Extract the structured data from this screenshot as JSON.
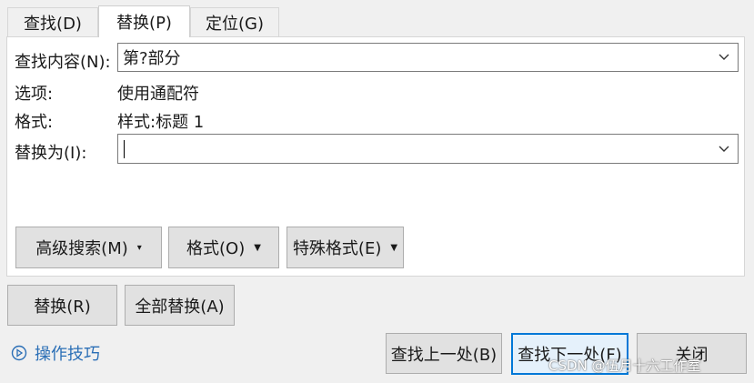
{
  "tabs": [
    "查找(D)",
    "替换(P)",
    "定位(G)"
  ],
  "find": {
    "label": "查找内容(N):",
    "value": "第?部分"
  },
  "options": {
    "label": "选项:",
    "value": "使用通配符"
  },
  "format": {
    "label": "格式:",
    "value": "样式:标题 1"
  },
  "replace": {
    "label": "替换为(I):",
    "value": ""
  },
  "panel_buttons": {
    "advanced": "高级搜索(M)",
    "format": "格式(O)",
    "special": "特殊格式(E)"
  },
  "action_buttons": {
    "replace": "替换(R)",
    "replace_all": "全部替换(A)"
  },
  "help": {
    "label": "操作技巧"
  },
  "footer_buttons": {
    "find_prev": "查找上一处(B)",
    "find_next": "查找下一处(F)",
    "close": "关闭"
  },
  "watermark": "CSDN @伍月十六工作室",
  "colors": {
    "accent": "#0078d7",
    "link": "#2b6fb6",
    "panel_bg": "#ffffff",
    "dialog_bg": "#f0f0f0"
  }
}
